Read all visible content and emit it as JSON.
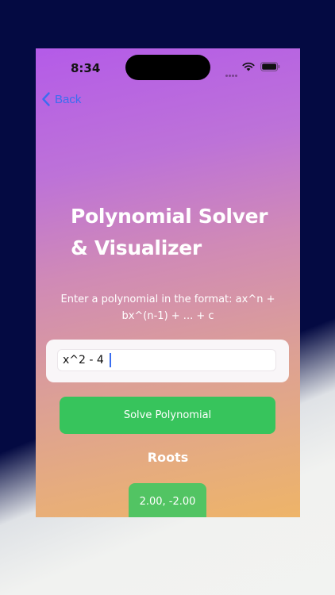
{
  "status_bar": {
    "time": "8:34"
  },
  "nav": {
    "back_label": "Back"
  },
  "screen": {
    "title": "Polynomial Solver\n& Visualizer",
    "instruction": "Enter a polynomial in the format: ax^n + bx^(n-1) + ... + c",
    "input_value": "x^2 - 4",
    "input_placeholder": "",
    "solve_label": "Solve Polynomial",
    "roots_heading": "Roots",
    "roots_value": "2.00, -2.00"
  },
  "icons": {
    "back": "chevron-left-icon",
    "wifi": "wifi-icon",
    "battery": "battery-icon",
    "signal": "signal-dots-icon"
  },
  "colors": {
    "accent_blue": "#3a6df0",
    "button_green": "#37c45c",
    "chip_green": "#52c463",
    "gradient_top": "#b45be8",
    "gradient_bottom": "#eeb468",
    "backdrop": "#040a42"
  }
}
